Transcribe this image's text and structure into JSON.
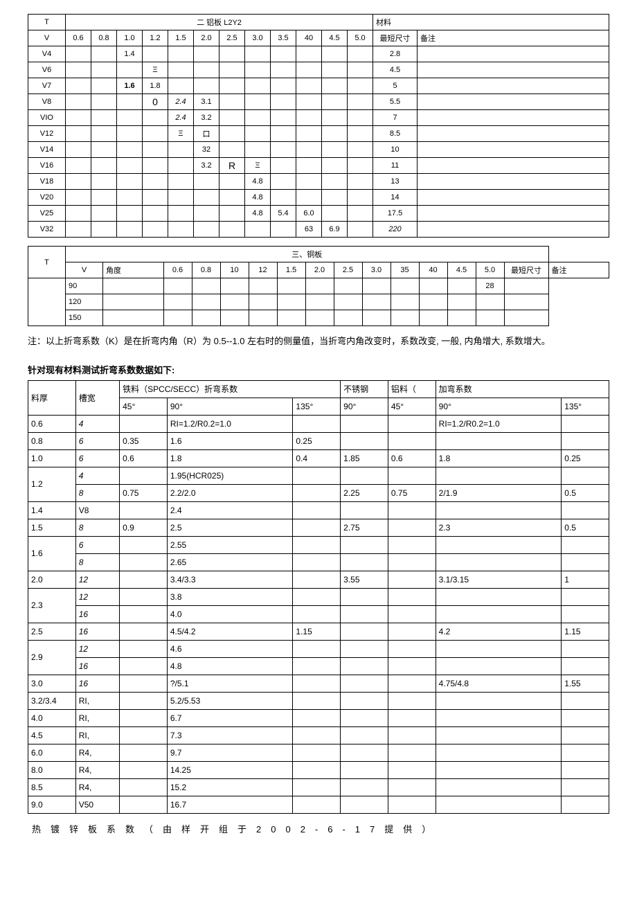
{
  "table1": {
    "title": "二 铝板 L2Y2",
    "material": "材料",
    "t": "T",
    "v": "V",
    "cols": [
      "0.6",
      "0.8",
      "1.0",
      "1.2",
      "1.5",
      "2.0",
      "2.5",
      "3.0",
      "3.5",
      "40",
      "4.5",
      "5.0"
    ],
    "minSizeHdr": "最短尺寸",
    "bz": "备注",
    "rows": [
      {
        "v": "V4",
        "c": [
          "",
          "",
          "1.4",
          "",
          "",
          "",
          "",
          "",
          "",
          "",
          "",
          ""
        ],
        "min": "2.8"
      },
      {
        "v": "V6",
        "c": [
          "",
          "",
          "",
          "Ξ",
          "",
          "",
          "",
          "",
          "",
          "",
          "",
          ""
        ],
        "min": "4.5"
      },
      {
        "v": "V7",
        "c": [
          "",
          "",
          "1.6",
          "1.8",
          "",
          "",
          "",
          "",
          "",
          "",
          "",
          ""
        ],
        "min": "5",
        "boldC": 2
      },
      {
        "v": "V8",
        "c": [
          "",
          "",
          "",
          "0",
          "2.4",
          "3.1",
          "",
          "",
          "",
          "",
          "",
          ""
        ],
        "min": "5.5",
        "big": 3,
        "itSet": [
          4
        ]
      },
      {
        "v": "VIO",
        "c": [
          "",
          "",
          "",
          "",
          "2.4",
          "3.2",
          "",
          "",
          "",
          "",
          "",
          ""
        ],
        "min": "7",
        "itSet": [
          4
        ]
      },
      {
        "v": "V12",
        "c": [
          "",
          "",
          "",
          "",
          "Ξ",
          "口",
          "",
          "",
          "",
          "",
          "",
          ""
        ],
        "min": "8.5"
      },
      {
        "v": "V14",
        "c": [
          "",
          "",
          "",
          "",
          "",
          "32",
          "",
          "",
          "",
          "",
          "",
          ""
        ],
        "min": "10"
      },
      {
        "v": "V16",
        "c": [
          "",
          "",
          "",
          "",
          "",
          "3.2",
          "R",
          "Ξ",
          "",
          "",
          "",
          ""
        ],
        "min": "11",
        "big": 6
      },
      {
        "v": "V18",
        "c": [
          "",
          "",
          "",
          "",
          "",
          "",
          "",
          "4.8",
          "",
          "",
          "",
          ""
        ],
        "min": "13"
      },
      {
        "v": "V20",
        "c": [
          "",
          "",
          "",
          "",
          "",
          "",
          "",
          "4.8",
          "",
          "",
          "",
          ""
        ],
        "min": "14"
      },
      {
        "v": "V25",
        "c": [
          "",
          "",
          "",
          "",
          "",
          "",
          "",
          "4.8",
          "5.4",
          "6.0",
          "",
          ""
        ],
        "min": "17.5"
      },
      {
        "v": "V32",
        "c": [
          "",
          "",
          "",
          "",
          "",
          "",
          "",
          "",
          "",
          "63",
          "6.9",
          ""
        ],
        "min": "220",
        "minIt": true
      }
    ]
  },
  "table2": {
    "t": "T",
    "v": "V",
    "title": "三、铜板",
    "angHdr": "角度",
    "cols": [
      "0.6",
      "0.8",
      "10",
      "12",
      "1.5",
      "2.0",
      "2.5",
      "3.0",
      "35",
      "40",
      "4.5",
      "5.0"
    ],
    "minSizeHdr": "最短尺寸",
    "bz": "备注",
    "angles": [
      "90",
      "120",
      "150"
    ],
    "min90": "28"
  },
  "note": "注：以上折弯系数（K）是在折弯内角（R）为 0.5--1.0 左右时的侧量值，当折弯内角改变时，系数改变, 一般, 内角增大, 系数增大。",
  "sectionTitle": "针对现有材料测试折弯系数数据如下:",
  "table3": {
    "hdr1": {
      "th": "料厚",
      "gw": "槽宽",
      "iron": "铁料（SPCC/SECC）折弯系数",
      "ss": "不锈钢",
      "al": "铝料（",
      "coef": "加弯系数"
    },
    "hdr2": [
      "45°",
      "90°",
      "135°",
      "90°",
      "45°",
      "90°",
      "135°"
    ],
    "rows": [
      {
        "th": "0.6",
        "gw": "4",
        "c": [
          "",
          "RI=1.2/R0.2=1.0",
          "",
          "",
          "",
          "RI=1.2/R0.2=1.0",
          ""
        ]
      },
      {
        "th": "0.8",
        "gw": "6",
        "c": [
          "0.35",
          "1.6",
          "0.25",
          "",
          "",
          "",
          ""
        ]
      },
      {
        "th": "1.0",
        "gw": "6",
        "c": [
          "0.6",
          "1.8",
          "0.4",
          "1.85",
          "0.6",
          "1.8",
          "0.25"
        ]
      },
      {
        "th": "1.2",
        "gw": "4",
        "c": [
          "",
          "1.95(HCR025)",
          "",
          "",
          "",
          "",
          ""
        ],
        "span": 2
      },
      {
        "gw": "8",
        "c": [
          "0.75",
          "2.2/2.0",
          "",
          "2.25",
          "0.75",
          "2/1.9",
          "0.5"
        ]
      },
      {
        "th": "1.4",
        "gw": "V8",
        "c": [
          "",
          "2.4",
          "",
          "",
          "",
          "",
          ""
        ]
      },
      {
        "th": "1.5",
        "gw": "8",
        "c": [
          "0.9",
          "2.5",
          "",
          "2.75",
          "",
          "2.3",
          "0.5"
        ]
      },
      {
        "th": "1.6",
        "gw": "6",
        "c": [
          "",
          "2.55",
          "",
          "",
          "",
          "",
          ""
        ],
        "span": 2
      },
      {
        "gw": "8",
        "c": [
          "",
          "2.65",
          "",
          "",
          "",
          "",
          ""
        ]
      },
      {
        "th": "2.0",
        "gw": "12",
        "c": [
          "",
          "3.4/3.3",
          "",
          "3.55",
          "",
          "3.1/3.15",
          "1"
        ]
      },
      {
        "th": "2.3",
        "gw": "12",
        "c": [
          "",
          "3.8",
          "",
          "",
          "",
          "",
          ""
        ],
        "span": 2
      },
      {
        "gw": "16",
        "c": [
          "",
          "4.0",
          "",
          "",
          "",
          "",
          ""
        ]
      },
      {
        "th": "2.5",
        "gw": "16",
        "c": [
          "",
          "4.5/4.2",
          "1.15",
          "",
          "",
          "4.2",
          "1.15"
        ]
      },
      {
        "th": "2.9",
        "gw": "12",
        "c": [
          "",
          "4.6",
          "",
          "",
          "",
          "",
          ""
        ],
        "span": 2
      },
      {
        "gw": "16",
        "c": [
          "",
          "4.8",
          "",
          "",
          "",
          "",
          ""
        ]
      },
      {
        "th": "3.0",
        "gw": "16",
        "c": [
          "",
          "?/5.1",
          "",
          "",
          "",
          "4.75/4.8",
          "1.55"
        ]
      },
      {
        "th": "3.2/3.4",
        "gw": "RI,",
        "c": [
          "",
          "5.2/5.53",
          "",
          "",
          "",
          "",
          ""
        ]
      },
      {
        "th": "4.0",
        "gw": "RI,",
        "c": [
          "",
          "6.7",
          "",
          "",
          "",
          "",
          ""
        ]
      },
      {
        "th": "4.5",
        "gw": "RI,",
        "c": [
          "",
          "7.3",
          "",
          "",
          "",
          "",
          ""
        ]
      },
      {
        "th": "6.0",
        "gw": "R4,",
        "c": [
          "",
          "9.7",
          "",
          "",
          "",
          "",
          ""
        ]
      },
      {
        "th": "8.0",
        "gw": "R4,",
        "c": [
          "",
          "14.25",
          "",
          "",
          "",
          "",
          ""
        ]
      },
      {
        "th": "8.5",
        "gw": "R4,",
        "c": [
          "",
          "15.2",
          "",
          "",
          "",
          "",
          ""
        ]
      },
      {
        "th": "9.0",
        "gw": "V50",
        "c": [
          "",
          "16.7",
          "",
          "",
          "",
          "",
          ""
        ]
      }
    ]
  },
  "footer": "热镀锌板系数（由样开组于2002-6-17提供）"
}
